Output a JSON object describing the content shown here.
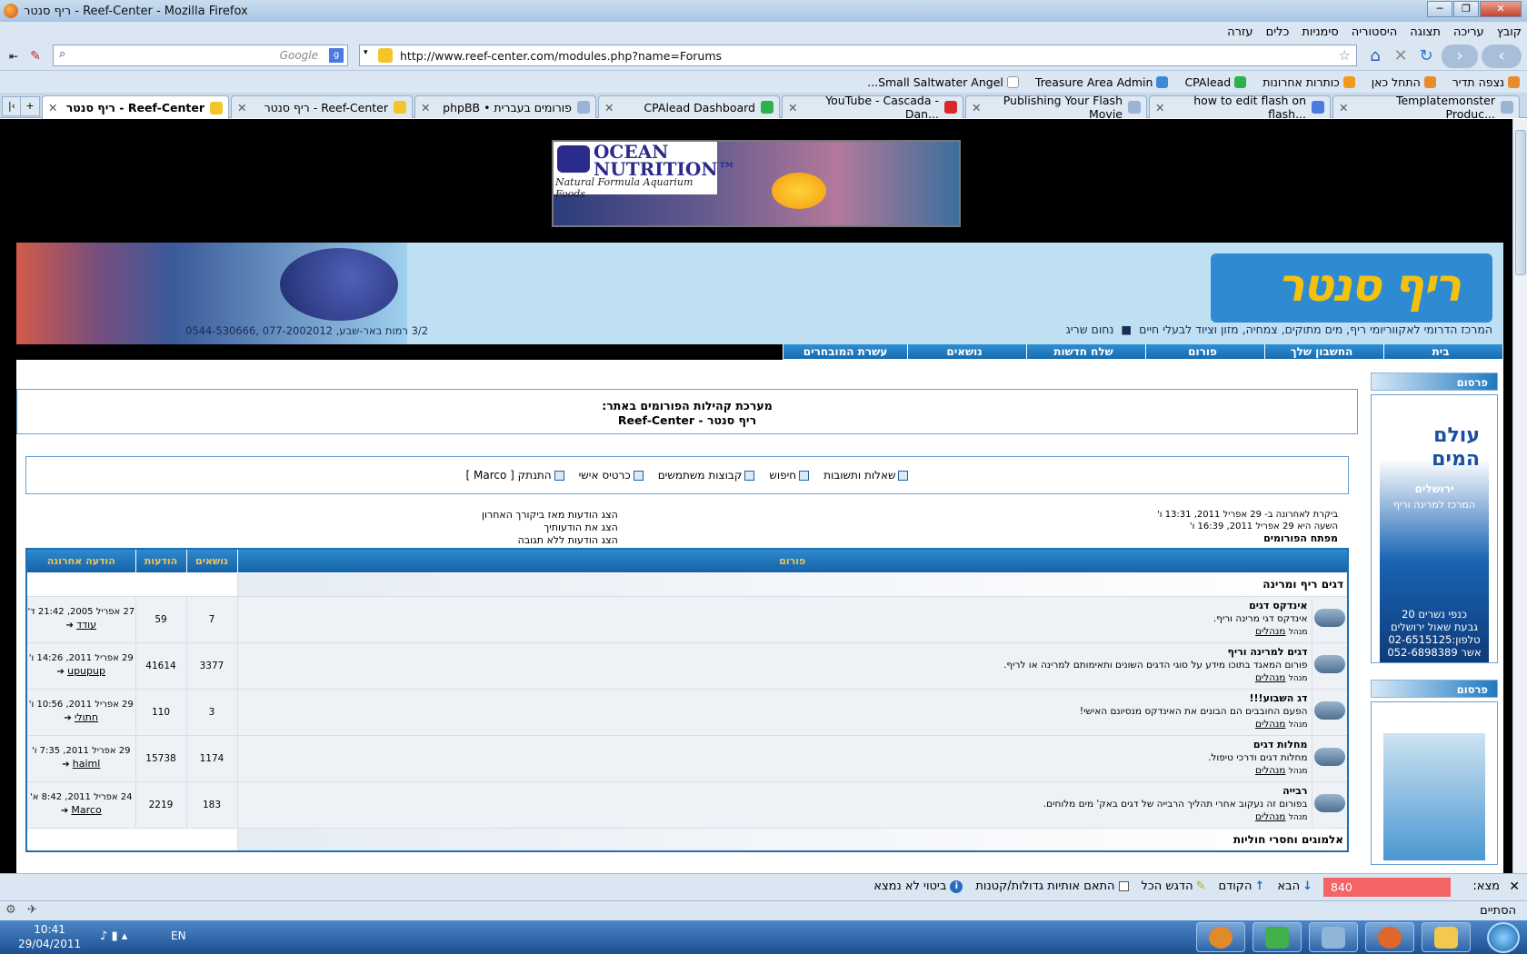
{
  "window": {
    "title": "ריף סנטר - Reef-Center - Mozilla Firefox"
  },
  "menu": [
    "קובץ",
    "עריכה",
    "תצוגה",
    "היסטוריה",
    "סימניות",
    "כלים",
    "עזרה"
  ],
  "search": {
    "placeholder": "Google"
  },
  "url": "http://www.reef-center.com/modules.php?name=Forums",
  "bookmarks": [
    "נצפה תדיר",
    "התחל כאן",
    "כותרות אחרונות",
    "CPAlead",
    "Treasure Area Admin",
    "Small Saltwater Angel..."
  ],
  "tabs": [
    {
      "label": "ריף סנטר - Reef-Center",
      "active": true
    },
    {
      "label": "ריף סנטר - Reef-Center"
    },
    {
      "label": "phpBB • פורומים בעברית"
    },
    {
      "label": "CPAlead Dashboard"
    },
    {
      "label": "YouTube - Cascada - Dan..."
    },
    {
      "label": "Publishing Your Flash Movie"
    },
    {
      "label": "how to edit flash on flash..."
    },
    {
      "label": "Templatemonster Produc..."
    }
  ],
  "banner": {
    "brand_line1": "OCEAN",
    "brand_line2": "NUTRITION™",
    "tagline": "Natural Formula Aquarium Foods"
  },
  "header": {
    "logo": "ריף סנטר",
    "tagline": "המרכז הדרומי לאקווריומי ריף, מים מתוקים, צמחיה, מזון וציוד לבעלי חיים",
    "owner": "נחום שריג",
    "address": "3/2 רמות באר-שבע, 077-2002012 ,0544-530666"
  },
  "nav": [
    "בית",
    "החשבון שלך",
    "פורום",
    "שלח חדשות",
    "נושאים",
    "עשרת המובחרים"
  ],
  "sidebar": {
    "ad_header": "פרסום",
    "ad1": {
      "title1": "עולם",
      "title2": "המים",
      "city": "ירושלים",
      "subtitle": "המרכז למרינה וריף",
      "addr1": "כנפי נשרים 20",
      "addr2": "גבעת שאול ירושלים",
      "phone1": "טלפון:02-6515125",
      "phone2": "אשר 052-6898389"
    }
  },
  "forum": {
    "title_line1": "מערכת קהילות הפורומים באתר:",
    "title_line2": "ריף סנטר - Reef-Center",
    "links": [
      "שאלות ותשובות",
      "חיפוש",
      "קבוצות משתמשים",
      "כרטיס אישי",
      "התנתק [ Marco ]"
    ],
    "last_visit": "ביקרת לאחרונה ב- 29 אפריל 2011, 13:31 ו'",
    "current_time": "השעה היא 29 אפריל 2011, 16:39 ו'",
    "index_label": "מפתח הפורומים",
    "quick_links": [
      "הצג הודעות מאז ביקורך האחרון",
      "הצג את הודעותיך",
      "הצג הודעות ללא תגובה"
    ],
    "columns": {
      "forum": "פורום",
      "topics": "נושאים",
      "posts": "הודעות",
      "last": "הודעה אחרונה"
    },
    "categories": [
      {
        "name": "דגים ריף ומרינה",
        "forums": [
          {
            "name": "אינדקס דגים",
            "desc": "אינדקס דגי מרינה וריף.",
            "mod_label": "מנהל",
            "mod": "מנהלים",
            "topics": "7",
            "posts": "59",
            "last_date": "27 אפריל 2005, 21:42 ד'",
            "last_user": "עודד"
          },
          {
            "name": "דגים למרינה וריף",
            "desc": "פורום המאגד בתוכו מידע על סוגי הדגים השונים ותאימותם למרינה או לריף.",
            "mod_label": "מנהל",
            "mod": "מנהלים",
            "topics": "3377",
            "posts": "41614",
            "last_date": "29 אפריל 2011, 14:26 ו'",
            "last_user": "upupup"
          },
          {
            "name": "דג השבוע!!!",
            "desc": "הפעם החובבים הם הבונים את האינדקס מנסיונם האישי!",
            "mod_label": "מנהל",
            "mod": "מנהלים",
            "topics": "3",
            "posts": "110",
            "last_date": "29 אפריל 2011, 10:56 ו'",
            "last_user": "חתולי"
          },
          {
            "name": "מחלות דגים",
            "desc": "מחלות דגים ודרכי טיפול.",
            "mod_label": "מנהל",
            "mod": "מנהלים",
            "topics": "1174",
            "posts": "15738",
            "last_date": "29 אפריל 2011, 7:35 ו'",
            "last_user": "haiml"
          },
          {
            "name": "רבייה",
            "desc": "בפורום זה נעקוב אחרי תהליך הרבייה של דגים באק' מים מלוחים.",
            "mod_label": "מנהל",
            "mod": "מנהלים",
            "topics": "183",
            "posts": "2219",
            "last_date": "24 אפריל 2011, 8:42 א'",
            "last_user": "Marco"
          }
        ]
      },
      {
        "name": "אלמוגים וחסרי חוליות",
        "forums": []
      }
    ]
  },
  "findbar": {
    "label": "מצא:",
    "value": "840",
    "next": "הבא",
    "prev": "הקודם",
    "highlight": "הדגש הכל",
    "match_case": "התאם אותיות גדולות/קטנות",
    "not_found": "ביטוי לא נמצא"
  },
  "status": "הסתיים",
  "taskbar": {
    "time": "10:41",
    "date": "29/04/2011",
    "lang": "EN"
  }
}
